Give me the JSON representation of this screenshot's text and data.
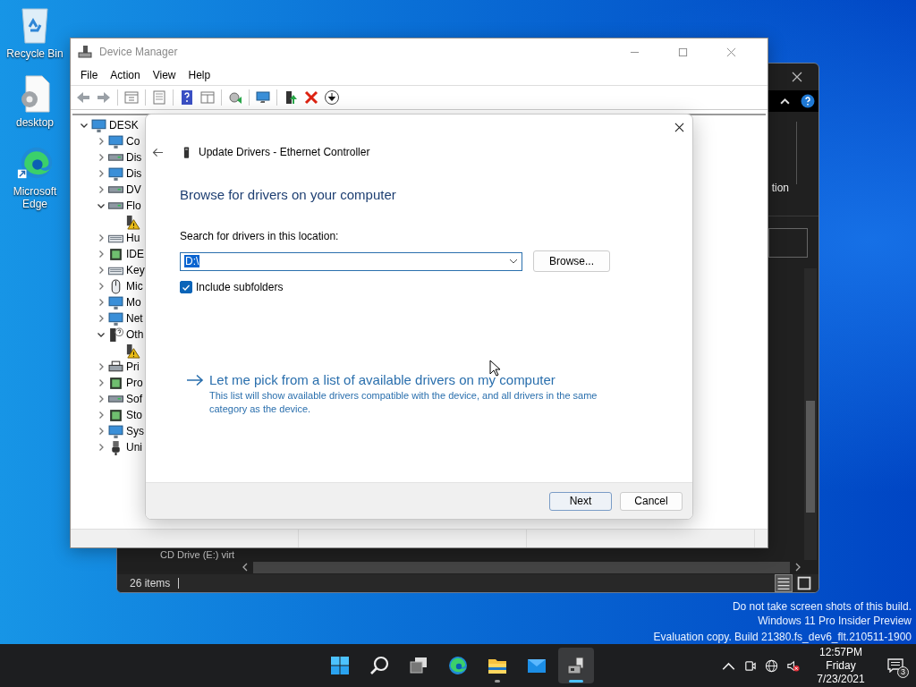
{
  "desktop_icons": [
    {
      "label": "Recycle Bin",
      "kind": "recycle"
    },
    {
      "label": "desktop",
      "kind": "settings-file"
    },
    {
      "label": "Microsoft Edge",
      "kind": "edge"
    }
  ],
  "explorer_window": {
    "ribbon_text": "tion",
    "row_text": "CD Drive (E:) virt",
    "status": "26 items"
  },
  "device_manager": {
    "title": "Device Manager",
    "menu": [
      "File",
      "Action",
      "View",
      "Help"
    ],
    "tree": {
      "label": "DESK",
      "kind": "computer",
      "expanded": true,
      "children": [
        {
          "label": "Co",
          "kind": "monitor",
          "expanded": false
        },
        {
          "label": "Dis",
          "kind": "drive",
          "expanded": false
        },
        {
          "label": "Dis",
          "kind": "monitor",
          "expanded": false
        },
        {
          "label": "DV",
          "kind": "drive",
          "expanded": false
        },
        {
          "label": "Flo",
          "kind": "drive",
          "expanded": true,
          "children": [
            {
              "kind": "warning"
            }
          ]
        },
        {
          "label": "Hu",
          "kind": "keyboard",
          "expanded": false
        },
        {
          "label": "IDE",
          "kind": "chip",
          "expanded": false
        },
        {
          "label": "Key",
          "kind": "keyboard",
          "expanded": false
        },
        {
          "label": "Mic",
          "kind": "mouse",
          "expanded": false
        },
        {
          "label": "Mo",
          "kind": "monitor",
          "expanded": false
        },
        {
          "label": "Net",
          "kind": "monitor",
          "expanded": false
        },
        {
          "label": "Oth",
          "kind": "unknown",
          "expanded": true,
          "children": [
            {
              "kind": "warning"
            }
          ]
        },
        {
          "label": "Pri",
          "kind": "printer",
          "expanded": false
        },
        {
          "label": "Pro",
          "kind": "chip",
          "expanded": false
        },
        {
          "label": "Sof",
          "kind": "drive",
          "expanded": false
        },
        {
          "label": "Sto",
          "kind": "chip",
          "expanded": false
        },
        {
          "label": "Sys",
          "kind": "monitor",
          "expanded": false
        },
        {
          "label": "Uni",
          "kind": "plug",
          "expanded": false
        }
      ]
    }
  },
  "dialog": {
    "title": "Update Drivers - Ethernet Controller",
    "heading": "Browse for drivers on your computer",
    "location_label": "Search for drivers in this location:",
    "location_value": "D:\\",
    "value_selected": true,
    "browse": "Browse...",
    "include_subfolders": {
      "label": "Include subfolders",
      "checked": true
    },
    "pick_link": {
      "title": "Let me pick from a list of available drivers on my computer",
      "description": "This list will show available drivers compatible with the device, and all drivers in the same category as the device."
    },
    "buttons": [
      {
        "label": "Next",
        "default": true
      },
      {
        "label": "Cancel",
        "default": false
      }
    ]
  },
  "build_notice": [
    "Do not take screen shots of this build.",
    "Windows 11 Pro Insider Preview",
    "Evaluation copy. Build 21380.fs_dev6_flt.210511-1900"
  ],
  "taskbar": {
    "apps": [
      {
        "kind": "start",
        "active": false,
        "running": false
      },
      {
        "kind": "search",
        "active": false,
        "running": false
      },
      {
        "kind": "task-view",
        "active": false,
        "running": false
      },
      {
        "kind": "edge",
        "active": false,
        "running": false
      },
      {
        "kind": "explorer",
        "active": false,
        "running": true
      },
      {
        "kind": "mail",
        "active": false,
        "running": false
      },
      {
        "kind": "device-manager",
        "active": true,
        "running": true
      }
    ],
    "time": "12:57PM",
    "day": "Friday",
    "date": "7/23/2021",
    "notifications": "3"
  }
}
